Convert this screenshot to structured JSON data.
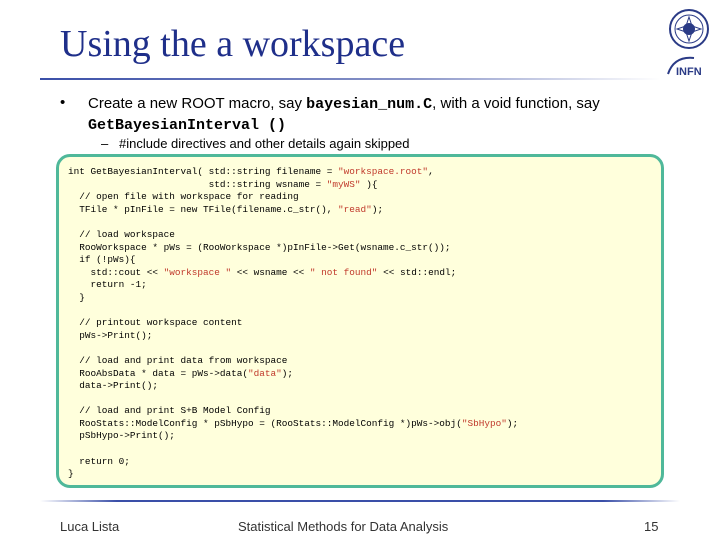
{
  "slide": {
    "title": "Using the a workspace",
    "logos": {
      "seal": "university-seal-icon",
      "infn": "INFN"
    },
    "bullet": {
      "marker": "•",
      "text_before": "Create a new ROOT macro, say ",
      "filename": "bayesian_num.C",
      "text_middle": ", with a void function, say ",
      "function_name": "GetBayesianInterval ()"
    },
    "sub_bullet": {
      "marker": "–",
      "text": "#include directives and other details again skipped"
    },
    "code": [
      {
        "segments": [
          {
            "t": "int GetBayesianInterval( std::string filename = "
          },
          {
            "t": "\"workspace.root\"",
            "s": true
          },
          {
            "t": ","
          }
        ]
      },
      {
        "segments": [
          {
            "t": "                         std::string wsname = "
          },
          {
            "t": "\"myWS\"",
            "s": true
          },
          {
            "t": " ){"
          }
        ]
      },
      {
        "segments": [
          {
            "t": "  // open file with workspace for reading"
          }
        ]
      },
      {
        "segments": [
          {
            "t": "  TFile * pInFile = new TFile(filename.c_str(), "
          },
          {
            "t": "\"read\"",
            "s": true
          },
          {
            "t": ");"
          }
        ]
      },
      {
        "gap": true
      },
      {
        "segments": [
          {
            "t": "  // load workspace"
          }
        ]
      },
      {
        "segments": [
          {
            "t": "  RooWorkspace * pWs = (RooWorkspace *)pInFile->Get(wsname.c_str());"
          }
        ]
      },
      {
        "segments": [
          {
            "t": "  if (!pWs){"
          }
        ]
      },
      {
        "segments": [
          {
            "t": "    std::cout << "
          },
          {
            "t": "\"workspace \"",
            "s": true
          },
          {
            "t": " << wsname << "
          },
          {
            "t": "\" not found\"",
            "s": true
          },
          {
            "t": " << std::endl;"
          }
        ]
      },
      {
        "segments": [
          {
            "t": "    return -1;"
          }
        ]
      },
      {
        "segments": [
          {
            "t": "  }"
          }
        ]
      },
      {
        "gap": true
      },
      {
        "segments": [
          {
            "t": "  // printout workspace content"
          }
        ]
      },
      {
        "segments": [
          {
            "t": "  pWs->Print();"
          }
        ]
      },
      {
        "gap": true
      },
      {
        "segments": [
          {
            "t": "  // load and print data from workspace"
          }
        ]
      },
      {
        "segments": [
          {
            "t": "  RooAbsData * data = pWs->data("
          },
          {
            "t": "\"data\"",
            "s": true
          },
          {
            "t": ");"
          }
        ]
      },
      {
        "segments": [
          {
            "t": "  data->Print();"
          }
        ]
      },
      {
        "gap": true
      },
      {
        "segments": [
          {
            "t": "  // load and print S+B Model Config"
          }
        ]
      },
      {
        "segments": [
          {
            "t": "  RooStats::ModelConfig * pSbHypo = (RooStats::ModelConfig *)pWs->obj("
          },
          {
            "t": "\"SbHypo\"",
            "s": true
          },
          {
            "t": ");"
          }
        ]
      },
      {
        "segments": [
          {
            "t": "  pSbHypo->Print();"
          }
        ]
      },
      {
        "gap": true
      },
      {
        "segments": [
          {
            "t": "  return 0;"
          }
        ]
      },
      {
        "segments": [
          {
            "t": "}"
          }
        ]
      }
    ],
    "footer": {
      "author": "Luca Lista",
      "course": "Statistical Methods for Data Analysis",
      "page_number": "15"
    },
    "colors": {
      "title": "#1f2f8a",
      "code_border": "#4fb89a",
      "code_background": "#ffffdc",
      "string_literal": "#c0392b"
    }
  }
}
